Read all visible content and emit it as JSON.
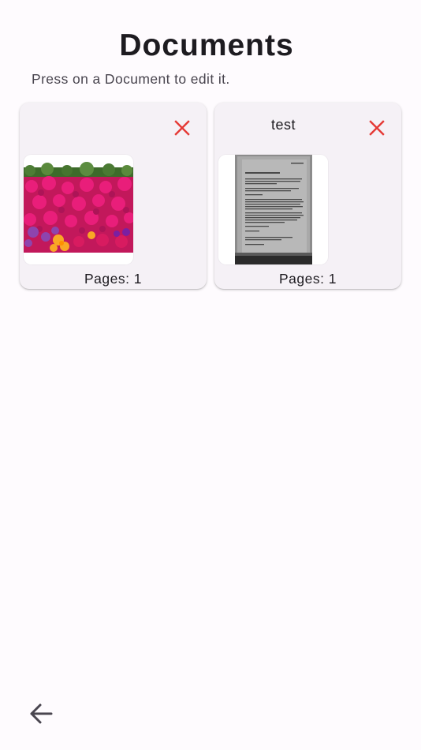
{
  "page": {
    "title": "Documents",
    "subtitle": "Press on a Document to edit it."
  },
  "documents": [
    {
      "name": "",
      "pages_label": "Pages: 1",
      "thumbnail": "flower-photo"
    },
    {
      "name": "test",
      "pages_label": "Pages: 1",
      "thumbnail": "scanned-document-page"
    }
  ],
  "icons": {
    "delete": "close-icon",
    "back": "arrow-back-icon"
  },
  "colors": {
    "background": "#fefbfe",
    "card": "#f5f1f6",
    "delete_icon": "#e53935",
    "text": "#1d1b20",
    "subtle_text": "#49454f"
  }
}
